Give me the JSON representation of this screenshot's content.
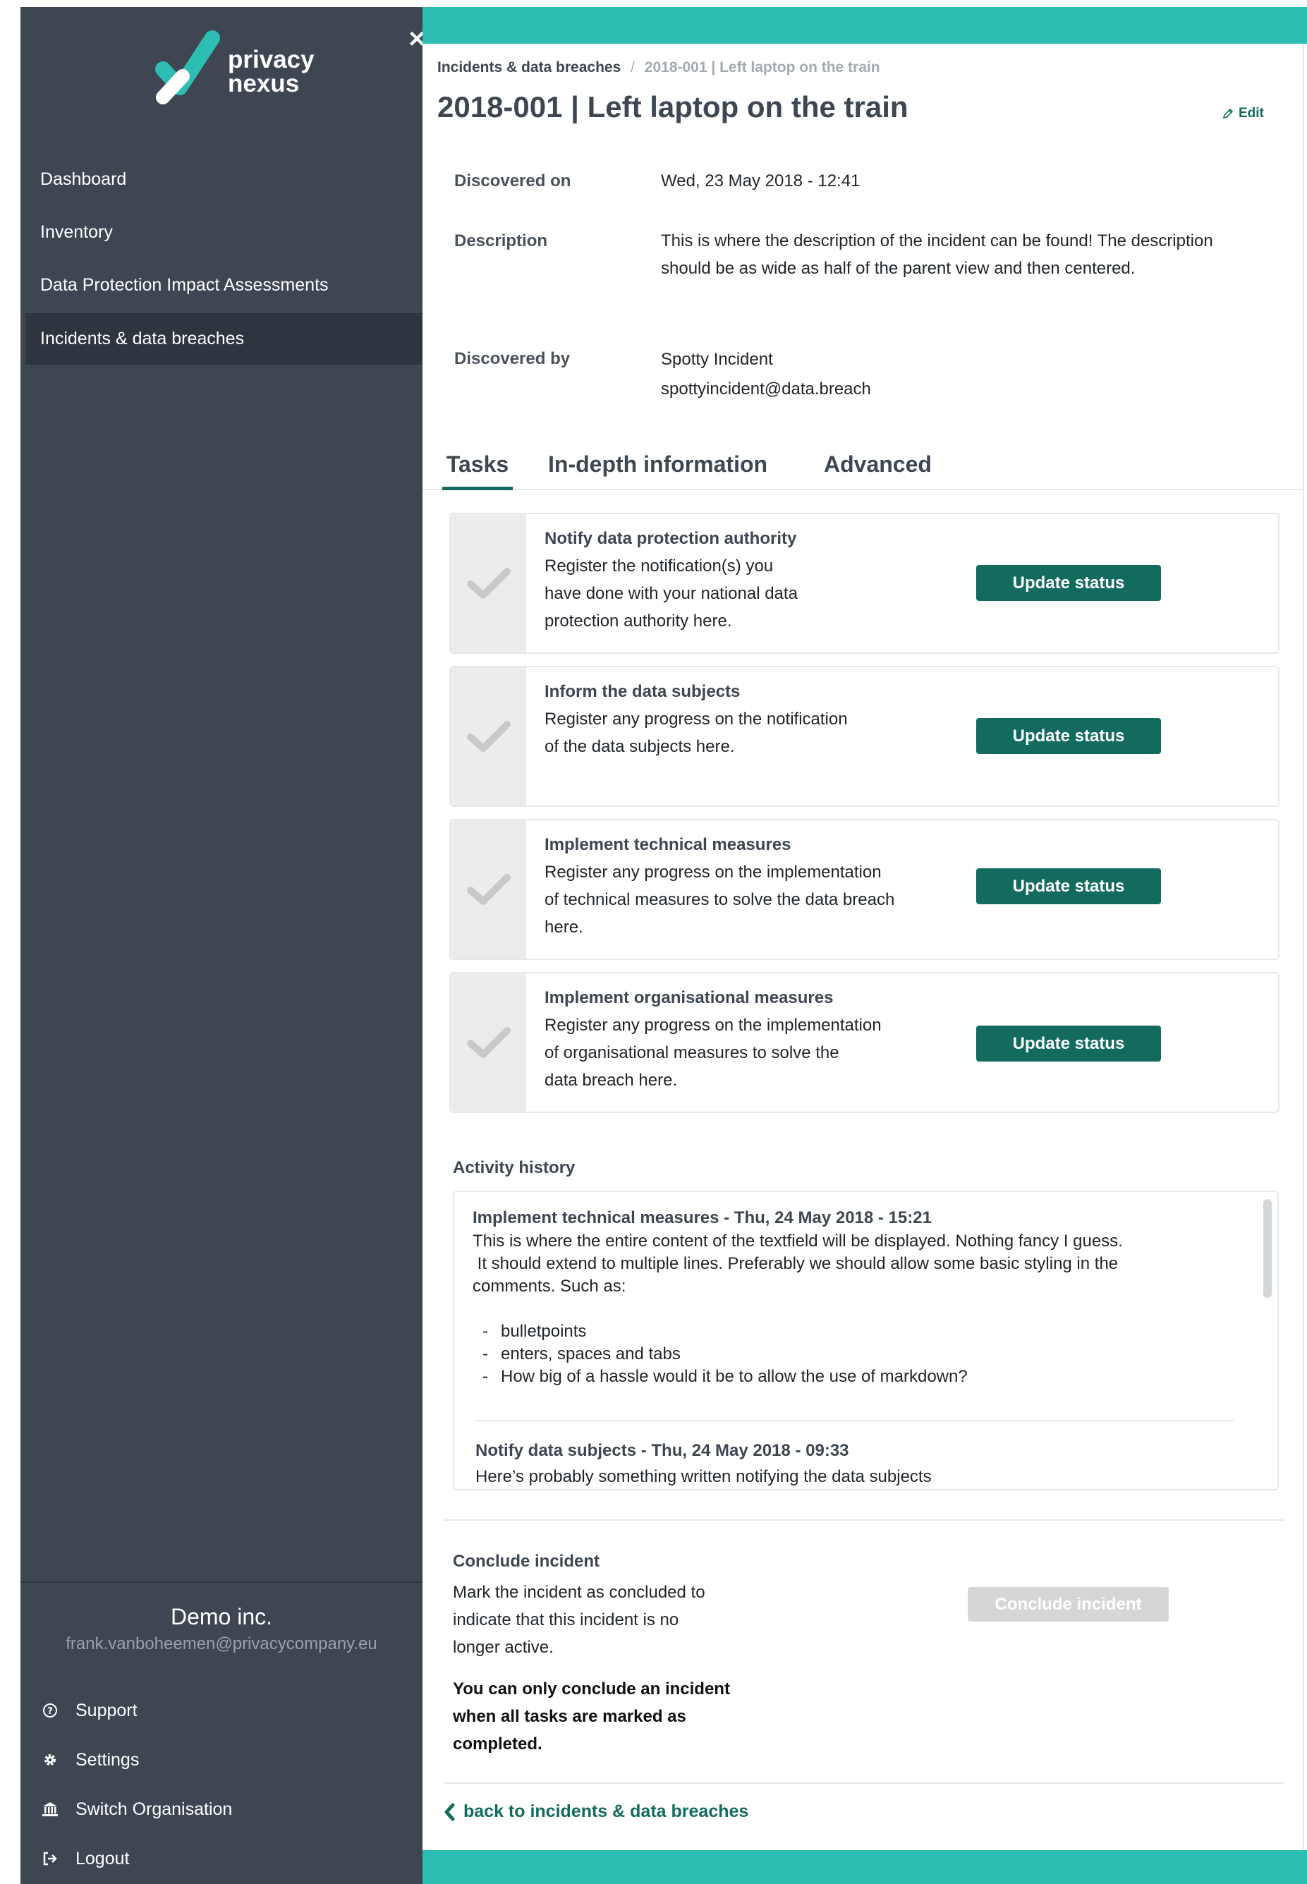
{
  "app": {
    "brand_line1": "privacy",
    "brand_line2": "nexus",
    "close_icon": "×"
  },
  "sidebar": {
    "items": [
      {
        "label": "Dashboard"
      },
      {
        "label": "Inventory"
      },
      {
        "label": "Data Protection Impact Assessments"
      },
      {
        "label": "Incidents & data breaches"
      }
    ],
    "organisation": {
      "name": "Demo inc.",
      "email": "frank.vanboheemen@privacycompany.eu"
    },
    "bottom_items": [
      {
        "label": "Support",
        "icon": "question-circle-icon"
      },
      {
        "label": "Settings",
        "icon": "gear-icon"
      },
      {
        "label": "Switch Organisation",
        "icon": "bank-icon"
      },
      {
        "label": "Logout",
        "icon": "logout-icon"
      }
    ]
  },
  "breadcrumb": {
    "parent": "Incidents & data breaches",
    "separator": "/",
    "current": "2018-001 | Left laptop on the train"
  },
  "incident": {
    "title": "2018-001 | Left laptop on the train",
    "edit_label": "Edit",
    "discovered_on_label": "Discovered on",
    "discovered_on_value": "Wed, 23 May 2018 - 12:41",
    "description_label": "Description",
    "description_value": "This is where the description of the incident can be found! The description should be as wide as half of the parent view and then centered.",
    "discovered_by_label": "Discovered by",
    "discovered_by_name": "Spotty Incident",
    "discovered_by_email": "spottyincident@data.breach"
  },
  "tabs": [
    {
      "label": "Tasks"
    },
    {
      "label": "In-depth information"
    },
    {
      "label": "Advanced"
    }
  ],
  "tasks": [
    {
      "title": "Notify data protection authority",
      "line1": "Register the notification(s) you",
      "line2": "have done with your national data",
      "line3": "protection authority here.",
      "button": "Update status"
    },
    {
      "title": "Inform the data subjects",
      "line1": "Register any progress on the notification",
      "line2": "of the data subjects here.",
      "line3": "",
      "button": "Update status"
    },
    {
      "title": "Implement technical measures",
      "line1": "Register any progress on the implementation",
      "line2": "of technical measures to solve the data breach",
      "line3": "here.",
      "button": "Update status"
    },
    {
      "title": "Implement organisational measures",
      "line1": "Register any progress on the implementation",
      "line2": "of organisational measures to solve the",
      "line3": "data breach here.",
      "button": "Update status"
    }
  ],
  "activity": {
    "title": "Activity history",
    "entries": [
      {
        "title": "Implement technical measures - Thu, 24 May 2018 - 15:21",
        "line1": "This is where the entire content of the textfield will be displayed. Nothing fancy I guess.",
        "line2": " It should extend to multiple lines. Preferably we should allow some basic styling in the",
        "line3": "comments. Such as:",
        "bullets": [
          "bulletpoints",
          "enters, spaces and tabs",
          "How big of a hassle would it be to allow the use of markdown?"
        ]
      },
      {
        "title": "Notify data subjects - Thu, 24 May 2018 - 09:33",
        "line1": "Here’s probably something written notifying the data subjects"
      }
    ]
  },
  "conclude": {
    "title": "Conclude incident",
    "line1": "Mark the incident as concluded to",
    "line2": "indicate that this incident is no",
    "line3": "longer active.",
    "warn1": "You can only conclude an incident",
    "warn2": "when all tasks are marked as",
    "warn3": "completed.",
    "button": "Conclude incident"
  },
  "back_link": "back to incidents & data breaches",
  "colors": {
    "accent": "#2dbdb3",
    "primary_button": "#136b5e",
    "sidebar": "#3d4651",
    "sidebar_active": "#2e353e",
    "disabled_button": "#d6d6d6"
  }
}
